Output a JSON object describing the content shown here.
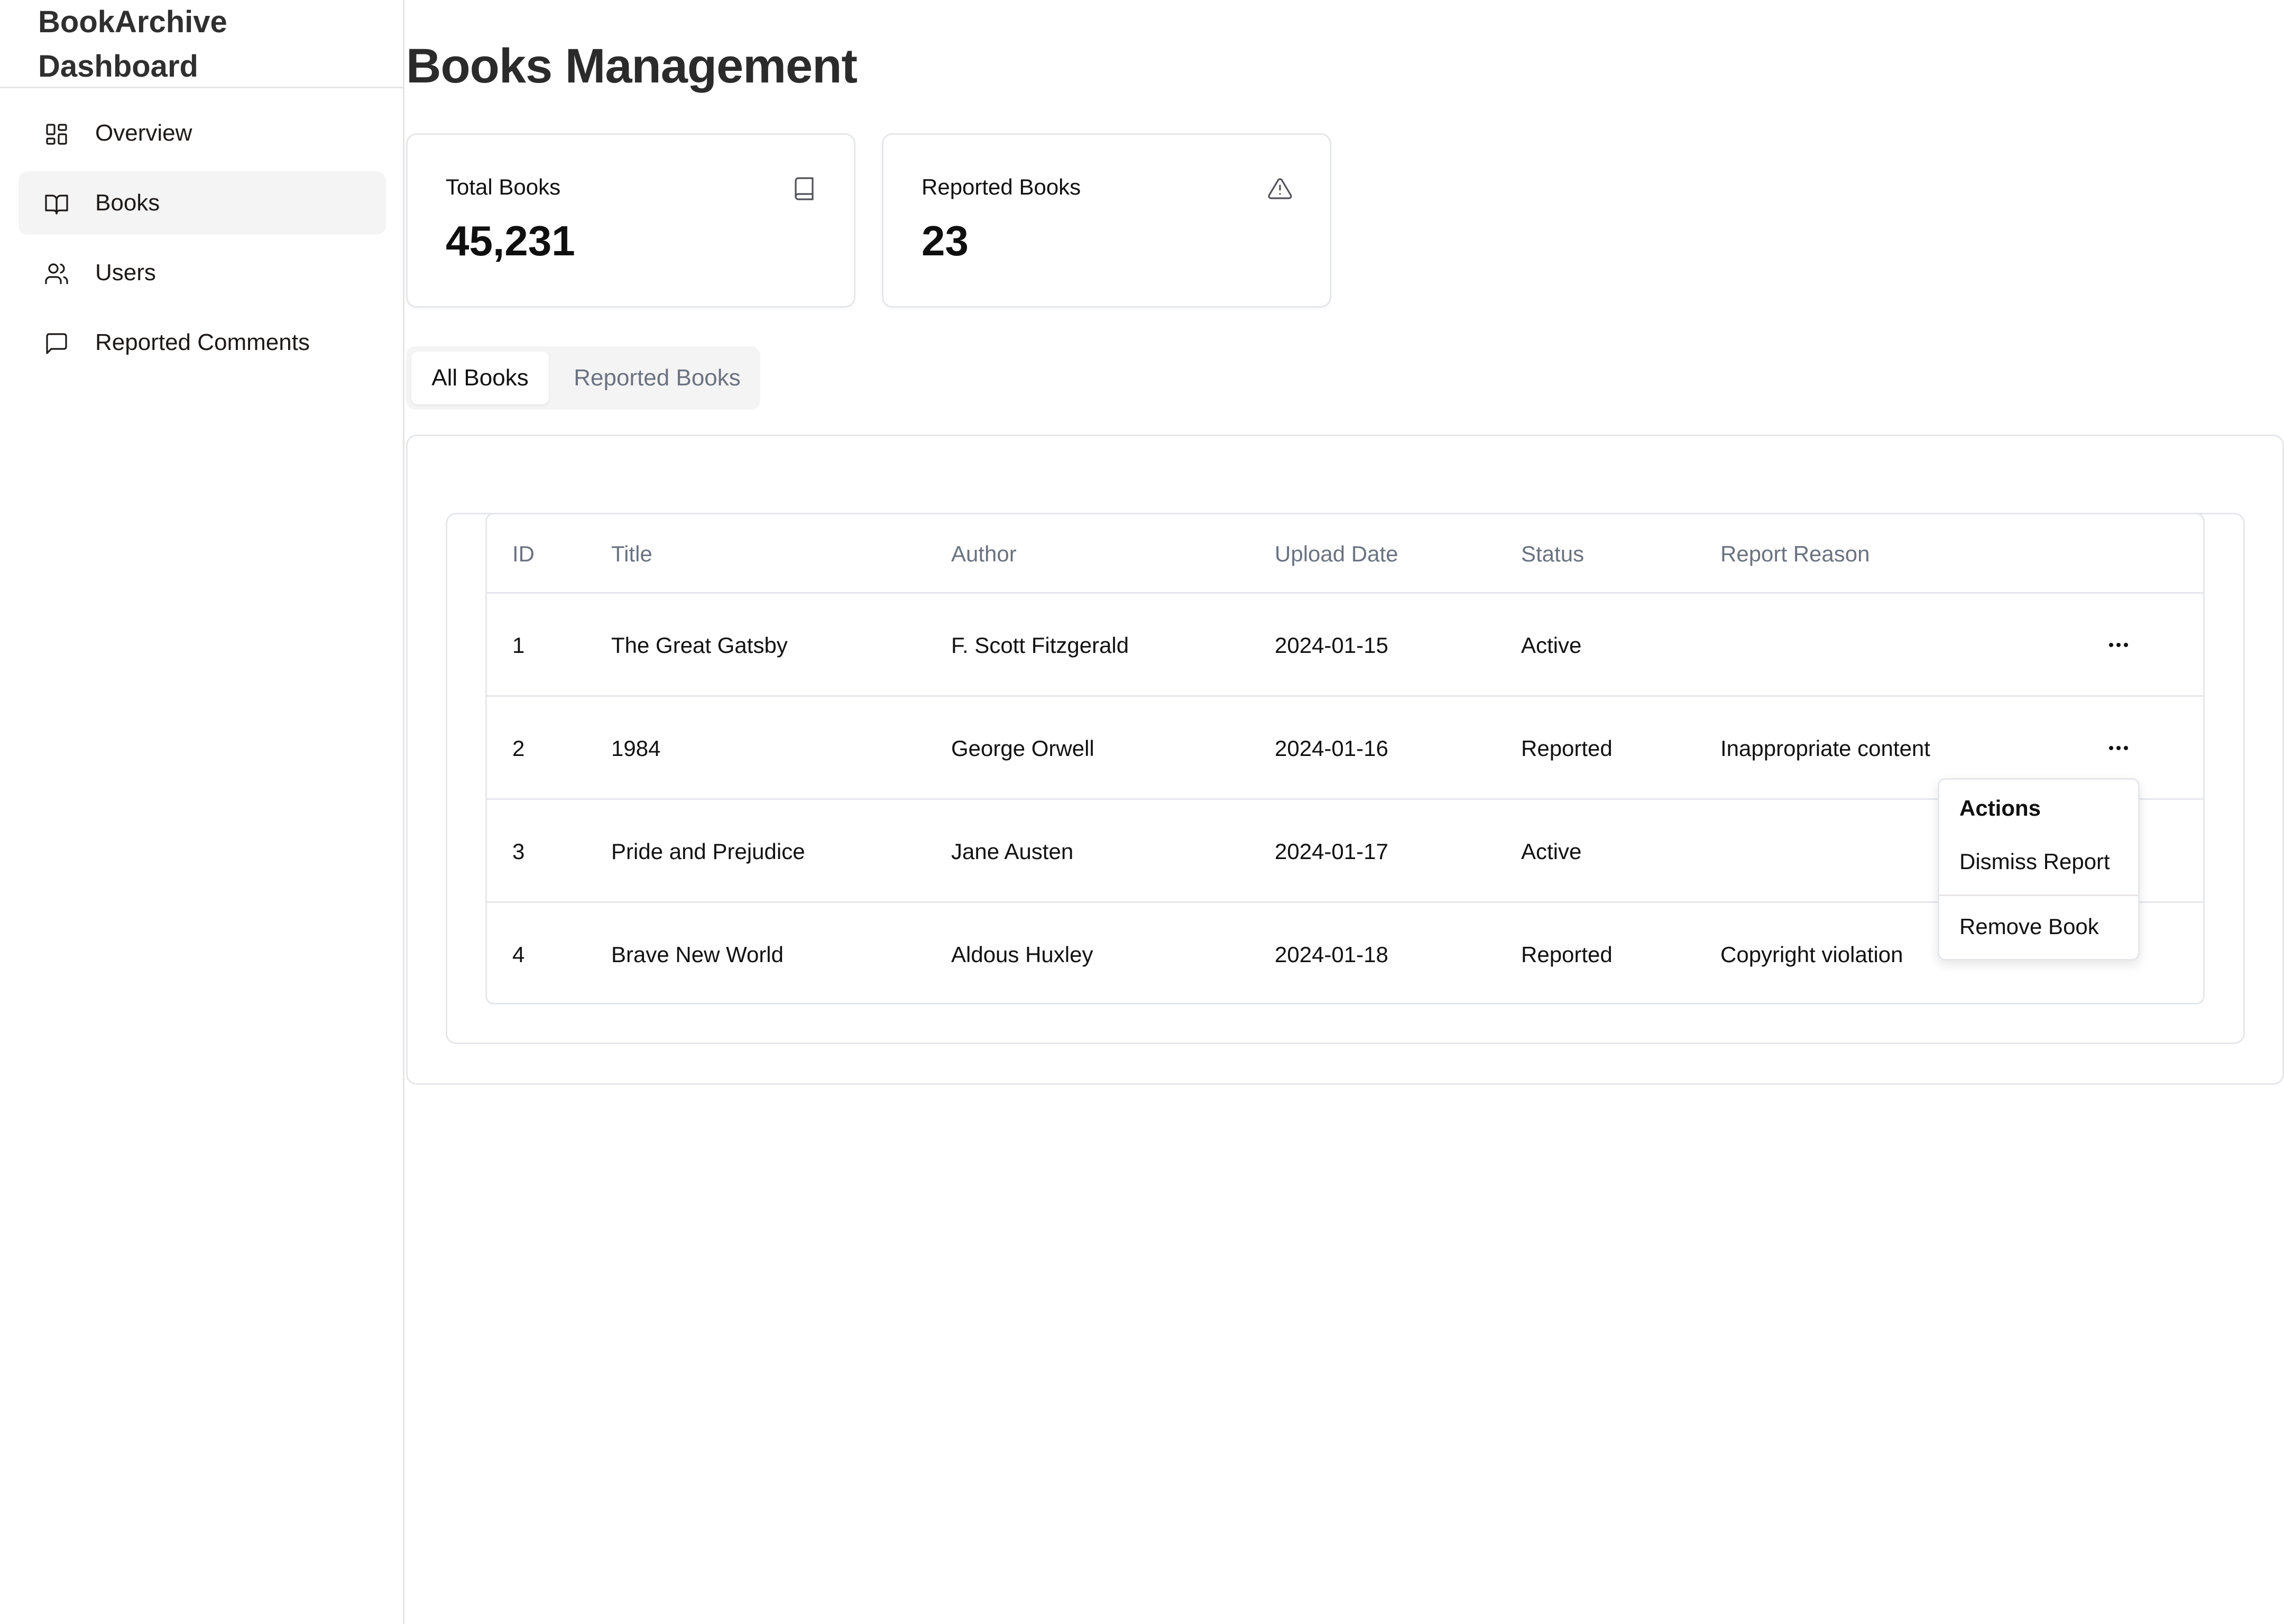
{
  "brand": {
    "line1": "BookArchive",
    "line2": "Dashboard"
  },
  "sidebar": {
    "items": [
      {
        "label": "Overview",
        "icon": "layout-dashboard-icon",
        "active": false
      },
      {
        "label": "Books",
        "icon": "book-open-icon",
        "active": true
      },
      {
        "label": "Users",
        "icon": "users-icon",
        "active": false
      },
      {
        "label": "Reported Comments",
        "icon": "message-square-icon",
        "active": false
      }
    ]
  },
  "page": {
    "title": "Books Management"
  },
  "stats": [
    {
      "label": "Total Books",
      "value": "45,231",
      "icon": "book-icon"
    },
    {
      "label": "Reported Books",
      "value": "23",
      "icon": "alert-triangle-icon"
    }
  ],
  "tabs": [
    {
      "label": "All Books",
      "active": true
    },
    {
      "label": "Reported Books",
      "active": false
    }
  ],
  "table": {
    "headers": [
      "ID",
      "Title",
      "Author",
      "Upload Date",
      "Status",
      "Report Reason"
    ],
    "rows": [
      {
        "id": "1",
        "title": "The Great Gatsby",
        "author": "F. Scott Fitzgerald",
        "date": "2024-01-15",
        "status": "Active",
        "reason": ""
      },
      {
        "id": "2",
        "title": "1984",
        "author": "George Orwell",
        "date": "2024-01-16",
        "status": "Reported",
        "reason": "Inappropriate content"
      },
      {
        "id": "3",
        "title": "Pride and Prejudice",
        "author": "Jane Austen",
        "date": "2024-01-17",
        "status": "Active",
        "reason": ""
      },
      {
        "id": "4",
        "title": "Brave New World",
        "author": "Aldous Huxley",
        "date": "2024-01-18",
        "status": "Reported",
        "reason": "Copyright violation"
      }
    ]
  },
  "dropdown": {
    "title": "Actions",
    "items": [
      "Dismiss Report",
      "Remove Book"
    ]
  }
}
